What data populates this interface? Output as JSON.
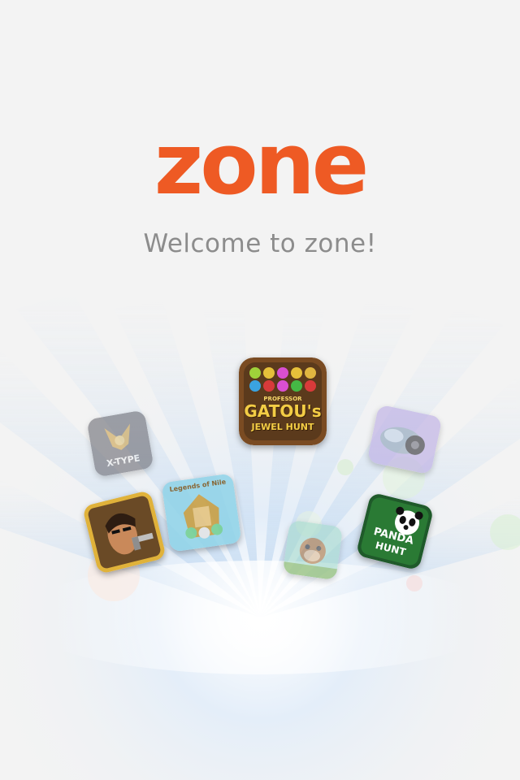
{
  "brand": {
    "logo_text": "zone",
    "accent": "#ee5a24"
  },
  "welcome_text": "Welcome to zone!",
  "game_icons": [
    {
      "name": "xtype-icon",
      "label": "X-TYPE"
    },
    {
      "name": "gatou-icon",
      "label_top": "PROFESSOR",
      "label_main": "GATOU's",
      "label_sub": "JEWEL HUNT"
    },
    {
      "name": "racing-icon"
    },
    {
      "name": "gunman-icon"
    },
    {
      "name": "egypt-icon",
      "label": "Legends of Nile"
    },
    {
      "name": "monkey-icon"
    },
    {
      "name": "panda-hunt-icon",
      "label_main": "PANDA",
      "label_sub": "HUNT"
    }
  ]
}
